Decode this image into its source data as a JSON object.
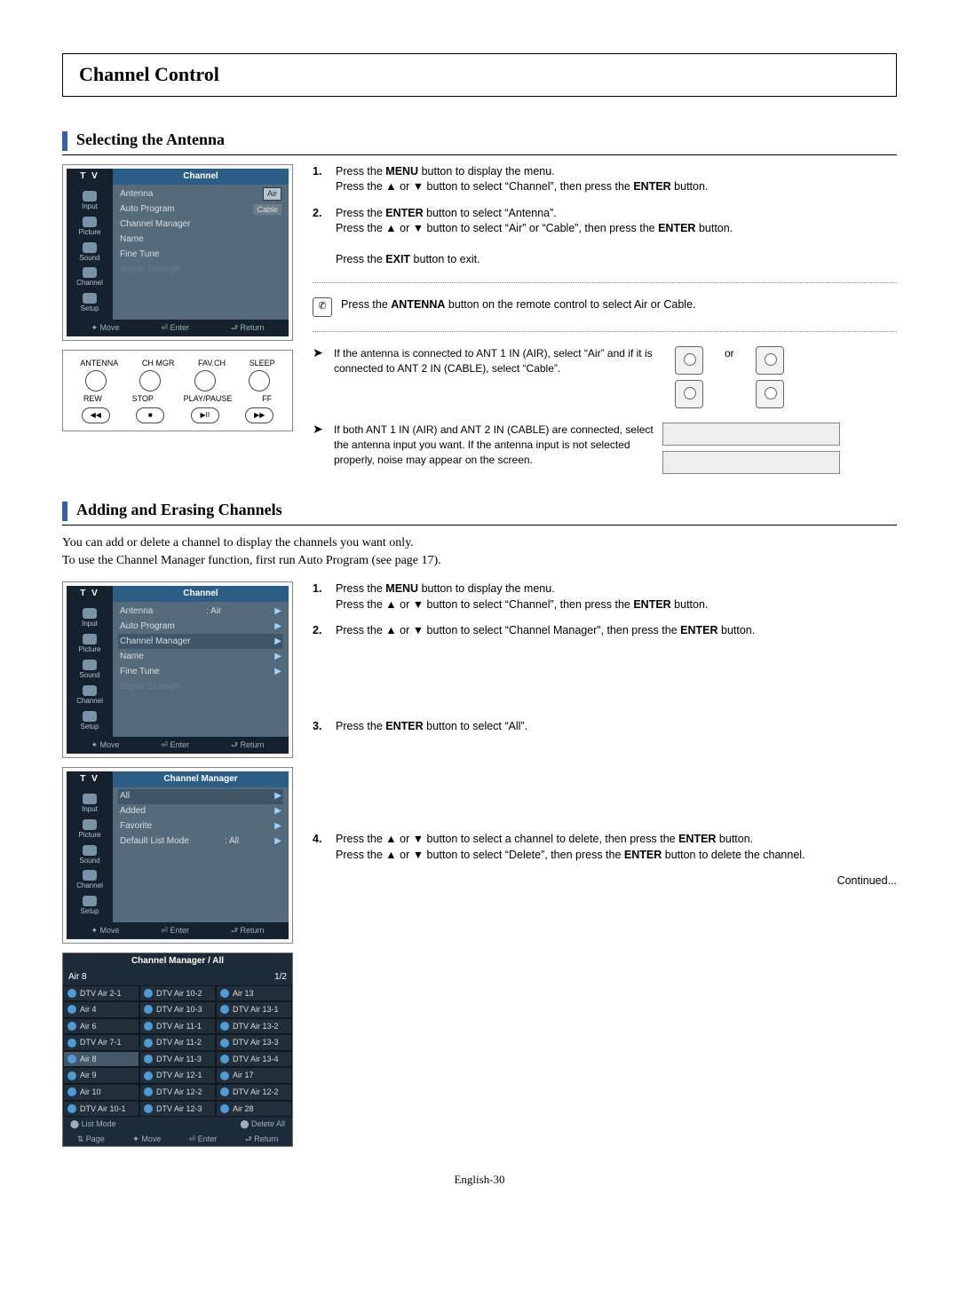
{
  "page_title": "Channel Control",
  "section1": {
    "heading": "Selecting the Antenna",
    "osd_title": "Channel",
    "side_items": [
      "Input",
      "Picture",
      "Sound",
      "Channel",
      "Setup"
    ],
    "menu1": [
      {
        "label": "Antenna",
        "value": "Air",
        "sel": true
      },
      {
        "label": "Auto Program",
        "value": "Cable"
      },
      {
        "label": "Channel Manager"
      },
      {
        "label": "Name"
      },
      {
        "label": "Fine Tune"
      },
      {
        "label": "Signal Strength",
        "dim": true
      }
    ],
    "footer": {
      "move": "Move",
      "enter": "Enter",
      "return": "Return"
    },
    "remote": {
      "top": [
        "ANTENNA",
        "CH MGR",
        "FAV.CH",
        "SLEEP"
      ],
      "bot": [
        "REW",
        "STOP",
        "PLAY/PAUSE",
        "FF"
      ],
      "ovals": [
        "◀◀",
        "■",
        "▶II",
        "▶▶"
      ]
    },
    "steps": {
      "s1a": "Press the ",
      "menu": "MENU",
      "s1b": " button to display the menu.",
      "s1c": "Press the ▲ or ▼ button to select “Channel”, then press the ",
      "enter": "ENTER",
      "s1d": " button.",
      "s2a": "Press the ",
      "s2b": " button to select “Antenna”.",
      "s2c": "Press the ▲ or ▼ button to select “Air” or “Cable”, then press the ",
      "s2d": " button.",
      "s2e": "Press the ",
      "exit": "EXIT",
      "s2f": " button to exit."
    },
    "hint": {
      "a": "Press the ",
      "antenna": "ANTENNA",
      "b": " button on the remote control to select Air or Cable."
    },
    "note1": "If the antenna is connected to ANT 1 IN (AIR), select “Air” and if it is connected to ANT 2 IN (CABLE), select “Cable”.",
    "or": "or",
    "note2": "If both ANT 1 IN (AIR) and ANT 2 IN (CABLE) are connected, select the antenna input you want. If the antenna input is not selected properly, noise may appear on the screen."
  },
  "section2": {
    "heading": "Adding and Erasing Channels",
    "intro1": "You can add or delete a channel to display the channels you want only.",
    "intro2": "To use the Channel Manager function, first run Auto Program (see page 17).",
    "osd_title": "Channel",
    "menu2": [
      {
        "label": "Antenna",
        "value": ": Air"
      },
      {
        "label": "Auto Program"
      },
      {
        "label": "Channel Manager",
        "hl": true
      },
      {
        "label": "Name"
      },
      {
        "label": "Fine Tune"
      },
      {
        "label": "Signal Strength",
        "dim": true
      }
    ],
    "osd_title2": "Channel Manager",
    "menu3": [
      {
        "label": "All",
        "hl": true
      },
      {
        "label": "Added"
      },
      {
        "label": "Favorite"
      },
      {
        "label": "Default List Mode",
        "value": ": All"
      }
    ],
    "cm_title": "Channel Manager / All",
    "cm_sel": "Air 8",
    "cm_page": "1/2",
    "cm_cols": [
      [
        "DTV Air 2-1",
        "Air 4",
        "Air 6",
        "DTV Air 7-1",
        "Air 8",
        "Air 9",
        "Air 10",
        "DTV Air 10-1"
      ],
      [
        "DTV Air 10-2",
        "DTV Air 10-3",
        "DTV Air 11-1",
        "DTV Air 11-2",
        "DTV Air 11-3",
        "DTV Air 12-1",
        "DTV Air 12-2",
        "DTV Air 12-3"
      ],
      [
        "Air 13",
        "DTV Air 13-1",
        "DTV Air 13-2",
        "DTV Air 13-3",
        "DTV Air 13-4",
        "Air 17",
        "DTV Air 12-2",
        "Air 28"
      ]
    ],
    "cm_sub": {
      "list": "List Mode",
      "del": "Delete All"
    },
    "cm_footer": {
      "page": "Page",
      "move": "Move",
      "enter": "Enter",
      "return": "Return"
    },
    "steps": {
      "s1a": "Press the ",
      "menu": "MENU",
      "s1b": " button to display the menu.",
      "s1c": "Press the ▲ or ▼ button to select “Channel”, then press the ",
      "enter": "ENTER",
      "s1d": " button.",
      "s2a": "Press the ▲ or ▼ button to select “Channel Manager”, then press the ",
      "s2b": " button.",
      "s3a": "Press the ",
      "s3b": " button to select “All”.",
      "s4a": "Press the ▲ or ▼ button to select a channel to delete, then press the ",
      "s4b": " button.",
      "s4c": "Press the ▲ or ▼ button to select “Delete”, then press the ",
      "s4d": " button to delete the channel."
    }
  },
  "continued": "Continued...",
  "page_num": "English-30"
}
